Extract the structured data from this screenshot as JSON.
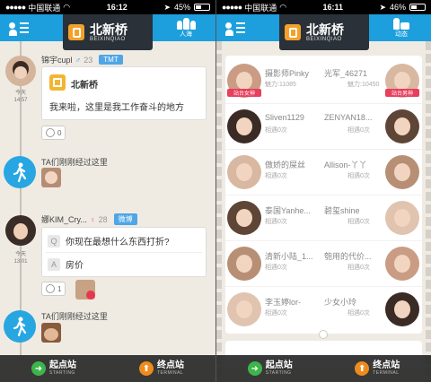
{
  "status_left": {
    "carrier": "中国联通",
    "time": "16:12",
    "battery": "45%",
    "battery_level": 0.45
  },
  "status_right": {
    "carrier": "中国联通",
    "time": "16:11",
    "battery": "46%",
    "battery_level": 0.46
  },
  "station": {
    "name": "北新桥",
    "pinyin": "BEIXINQIAO"
  },
  "nav": {
    "left_right_label": "人海",
    "right_right_label": "动态"
  },
  "feed": [
    {
      "type": "post",
      "user": "锦宇cupl",
      "gender": "♂",
      "age": "23",
      "tag": "TMT",
      "time_day": "今天",
      "time_clock": "14:57",
      "card_title": "北新桥",
      "card_text": "我来啦，这里是我工作奋斗的地方",
      "likes": "0"
    },
    {
      "type": "passby",
      "text": "TA们刚刚经过这里"
    },
    {
      "type": "qa",
      "user": "娜KIM_Cry...",
      "gender": "♀",
      "age": "28",
      "tag": "微博",
      "time_day": "今天",
      "time_clock": "13:01",
      "q_letter": "Q",
      "question": "你现在最想什么东西打折?",
      "a_letter": "A",
      "answer": "房价",
      "likes": "1"
    },
    {
      "type": "passby",
      "text": "TA们刚刚经过这里"
    }
  ],
  "bottom": {
    "start_label": "起点站",
    "start_sub": "STARTING",
    "end_label": "终点站",
    "end_sub": "TERMINAL",
    "overlap_text": "TA们刚刚经过这里"
  },
  "people": {
    "left": [
      {
        "name": "摄影师Pinky",
        "sub": "魅力:11085",
        "badge": "站台女神"
      },
      {
        "name": "Sliven1129",
        "sub": "相遇0次",
        "badge": ""
      },
      {
        "name": "傲娇的屎丝",
        "sub": "相遇0次",
        "badge": ""
      },
      {
        "name": "泰国Yanhe...",
        "sub": "相遇0次",
        "badge": ""
      },
      {
        "name": "清新小陆_1...",
        "sub": "相遇0次",
        "badge": ""
      },
      {
        "name": "李玉婷lor-",
        "sub": "相遇0次",
        "badge": ""
      }
    ],
    "right": [
      {
        "name": "光军_46271",
        "sub": "魅力:10450",
        "badge": "站台男神"
      },
      {
        "name": "ZENYAN18...",
        "sub": "相遇0次",
        "badge": ""
      },
      {
        "name": "Allison-丫丫",
        "sub": "相遇0次",
        "badge": ""
      },
      {
        "name": "碧玺shine",
        "sub": "相遇0次",
        "badge": ""
      },
      {
        "name": "匏用的代价...",
        "sub": "相遇0次",
        "badge": ""
      },
      {
        "name": "少女小玲",
        "sub": "相遇0次",
        "badge": ""
      }
    ]
  },
  "colors": {
    "brand": "#1d9fdd",
    "station_bg": "#2a3138",
    "station_icon": "#f3a12a",
    "start": "#3cb54a",
    "end": "#f08a1c",
    "badge": "#e83f5d"
  }
}
